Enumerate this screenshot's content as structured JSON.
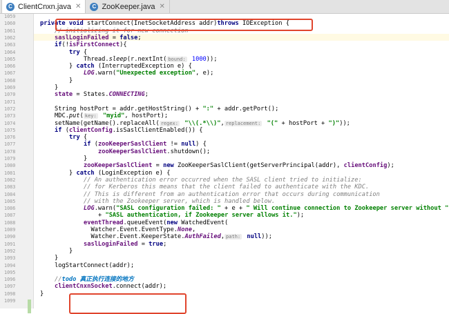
{
  "tabs": [
    {
      "label": "ClientCnxn.java",
      "icon": "class-icon",
      "active": true
    },
    {
      "label": "ZooKeeper.java",
      "icon": "class-icon",
      "active": false
    }
  ],
  "lines": [
    {
      "num": "1059",
      "text": ""
    },
    {
      "num": "1060",
      "text": ""
    },
    {
      "num": "1061",
      "text": ""
    },
    {
      "num": "1062",
      "text": ""
    },
    {
      "num": "1063",
      "text": ""
    },
    {
      "num": "1064",
      "text": ""
    },
    {
      "num": "1065",
      "text": ""
    },
    {
      "num": "1066",
      "text": ""
    },
    {
      "num": "1067",
      "text": ""
    },
    {
      "num": "1068",
      "text": ""
    },
    {
      "num": "1069",
      "text": ""
    },
    {
      "num": "1070",
      "text": ""
    },
    {
      "num": "1071",
      "text": ""
    },
    {
      "num": "1072",
      "text": ""
    },
    {
      "num": "1073",
      "text": ""
    },
    {
      "num": "1074",
      "text": ""
    },
    {
      "num": "1075",
      "text": ""
    },
    {
      "num": "1076",
      "text": ""
    },
    {
      "num": "1077",
      "text": ""
    },
    {
      "num": "1078",
      "text": ""
    },
    {
      "num": "1079",
      "text": ""
    },
    {
      "num": "1080",
      "text": ""
    },
    {
      "num": "1081",
      "text": ""
    },
    {
      "num": "1082",
      "text": ""
    },
    {
      "num": "1083",
      "text": ""
    },
    {
      "num": "1084",
      "text": ""
    },
    {
      "num": "1085",
      "text": ""
    },
    {
      "num": "1086",
      "text": ""
    },
    {
      "num": "1087",
      "text": ""
    },
    {
      "num": "1088",
      "text": ""
    },
    {
      "num": "1089",
      "text": ""
    },
    {
      "num": "1090",
      "text": ""
    },
    {
      "num": "1091",
      "text": ""
    },
    {
      "num": "1092",
      "text": ""
    },
    {
      "num": "1093",
      "text": ""
    },
    {
      "num": "1094",
      "text": ""
    },
    {
      "num": "1095",
      "text": ""
    },
    {
      "num": "1096",
      "text": ""
    },
    {
      "num": "1097",
      "text": ""
    },
    {
      "num": "1098",
      "text": ""
    },
    {
      "num": "1099",
      "text": ""
    }
  ],
  "code": {
    "l1060": [
      "private",
      "void",
      "startConnect(InetSocketAddress addr)",
      "throws",
      "IOException {"
    ],
    "l1061": "// initializing it for new connection",
    "l1062": [
      "saslLoginFailed",
      " = ",
      "false",
      ";"
    ],
    "l1063": [
      "if",
      "(!",
      "isFirstConnect",
      "){"
    ],
    "l1064": [
      "try",
      " {"
    ],
    "l1065": [
      "Thread.",
      "sleep",
      "(r.nextInt(",
      "bound:",
      "1000",
      "));"
    ],
    "l1066": [
      "} ",
      "catch",
      " (InterruptedException e) {"
    ],
    "l1067": [
      "LOG",
      ".warn(",
      "\"Unexpected exception\"",
      ", e);"
    ],
    "l1068": "}",
    "l1069": "}",
    "l1070": [
      "state",
      " = States.",
      "CONNECTING",
      ";"
    ],
    "l1072": [
      "String hostPort = addr.getHostString() + ",
      "\":\"",
      " + addr.getPort();"
    ],
    "l1073": [
      "MDC.",
      "put",
      "(",
      "key:",
      "\"myid\"",
      ", hostPort);"
    ],
    "l1074": [
      "setName(getName().replaceAll(",
      "regex:",
      "\"\\\\(.*\\\\)\"",
      ",",
      "replacement:",
      "\"(\"",
      " + hostPort + ",
      "\")\"",
      "));"
    ],
    "l1075": [
      "if",
      " (",
      "clientConfig",
      ".isSaslClientEnabled()) {"
    ],
    "l1076": [
      "try",
      " {"
    ],
    "l1077": [
      "if",
      " (",
      "zooKeeperSaslClient",
      " != ",
      "null",
      ") {"
    ],
    "l1078": [
      "zooKeeperSaslClient",
      ".shutdown();"
    ],
    "l1079": "}",
    "l1080": [
      "zooKeeperSaslClient",
      " = ",
      "new",
      " ZooKeeperSaslClient(getServerPrincipal(addr), ",
      "clientConfig",
      ");"
    ],
    "l1081": [
      "} ",
      "catch",
      " (LoginException e) {"
    ],
    "l1082": "// An authentication error occurred when the SASL client tried to initialize:",
    "l1083": "// for Kerberos this means that the client failed to authenticate with the KDC.",
    "l1084": "// This is different from an authentication error that occurs during communication",
    "l1085": "// with the Zookeeper server, which is handled below.",
    "l1086": [
      "LOG",
      ".warn(",
      "\"SASL configuration failed: \"",
      " + e + ",
      "\" Will continue connection to Zookeeper server without \""
    ],
    "l1087": [
      "+ ",
      "\"SASL authentication, if Zookeeper server allows it.\"",
      ");"
    ],
    "l1088": [
      "eventThread",
      ".queueEvent(",
      "new",
      " WatchedEvent("
    ],
    "l1089": [
      "Watcher.Event.EventType.",
      "None",
      ","
    ],
    "l1090": [
      "Watcher.Event.KeeperState.",
      "AuthFailed",
      ",",
      "path:",
      "null",
      "));"
    ],
    "l1091": [
      "saslLoginFailed",
      " = ",
      "true",
      ";"
    ],
    "l1092": "}",
    "l1093": "}",
    "l1094": "logStartConnect(addr);",
    "l1096": [
      "//",
      "todo",
      " 真正执行连接的地方"
    ],
    "l1097": [
      "clientCnxnSocket",
      ".connect(addr);"
    ],
    "l1098": "}"
  },
  "colors": {
    "highlight": "#e0442c",
    "keyword": "#000080",
    "string": "#008000",
    "field": "#660e7a",
    "comment": "#808080",
    "todo": "#0073bf"
  }
}
